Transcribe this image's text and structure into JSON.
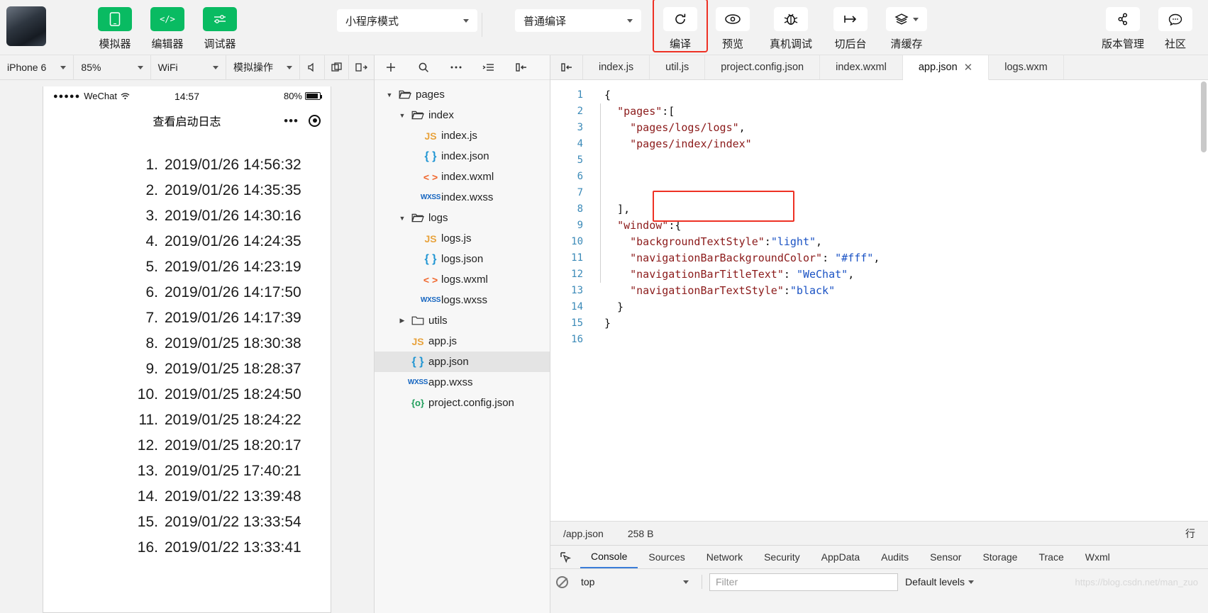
{
  "toolbar": {
    "avatar_name": "user-avatar",
    "panels": [
      {
        "label": "模拟器",
        "icon": "simulator-icon",
        "active": true
      },
      {
        "label": "编辑器",
        "icon": "editor-code-icon",
        "active": true
      },
      {
        "label": "调试器",
        "icon": "debugger-sliders-icon",
        "active": true
      }
    ],
    "mode_select": {
      "value": "小程序模式",
      "name": "mini-program-mode-select"
    },
    "compile_select": {
      "value": "普通编译",
      "name": "compile-mode-select"
    },
    "actions": [
      {
        "label": "编译",
        "icon": "refresh-icon",
        "highlighted": true
      },
      {
        "label": "预览",
        "icon": "eye-icon",
        "highlighted": false
      },
      {
        "label": "真机调试",
        "icon": "bug-icon",
        "highlighted": false
      },
      {
        "label": "切后台",
        "icon": "background-switch-icon",
        "highlighted": false
      },
      {
        "label": "清缓存",
        "icon": "layers-icon",
        "highlighted": false,
        "has_caret": true
      }
    ],
    "right_actions": [
      {
        "label": "版本管理",
        "icon": "git-branch-icon"
      },
      {
        "label": "社区",
        "icon": "chat-bubble-icon"
      }
    ],
    "highlight_color": "#ee3124",
    "accent_green": "#09bb62"
  },
  "simulator": {
    "controls": [
      {
        "value": "iPhone 6",
        "name": "device-select"
      },
      {
        "value": "85%",
        "name": "zoom-select"
      },
      {
        "value": "WiFi",
        "name": "network-select"
      },
      {
        "value": "模拟操作",
        "name": "simulate-action-select"
      }
    ],
    "icons": [
      "volume-icon",
      "copy-window-icon",
      "rotate-device-icon"
    ],
    "phone": {
      "status_bar": {
        "carrier": "WeChat",
        "signal_dots": "●●●●●",
        "time": "14:57",
        "battery_pct": "80%"
      },
      "nav_title": "查看启动日志",
      "logs": [
        {
          "index": "1.",
          "text": "2019/01/26 14:56:32"
        },
        {
          "index": "2.",
          "text": "2019/01/26 14:35:35"
        },
        {
          "index": "3.",
          "text": "2019/01/26 14:30:16"
        },
        {
          "index": "4.",
          "text": "2019/01/26 14:24:35"
        },
        {
          "index": "5.",
          "text": "2019/01/26 14:23:19"
        },
        {
          "index": "6.",
          "text": "2019/01/26 14:17:50"
        },
        {
          "index": "7.",
          "text": "2019/01/26 14:17:39"
        },
        {
          "index": "8.",
          "text": "2019/01/25 18:30:38"
        },
        {
          "index": "9.",
          "text": "2019/01/25 18:28:37"
        },
        {
          "index": "10.",
          "text": "2019/01/25 18:24:50"
        },
        {
          "index": "11.",
          "text": "2019/01/25 18:24:22"
        },
        {
          "index": "12.",
          "text": "2019/01/25 18:20:17"
        },
        {
          "index": "13.",
          "text": "2019/01/25 17:40:21"
        },
        {
          "index": "14.",
          "text": "2019/01/22 13:39:48"
        },
        {
          "index": "15.",
          "text": "2019/01/22 13:33:54"
        },
        {
          "index": "16.",
          "text": "2019/01/22 13:33:41"
        }
      ]
    }
  },
  "file_tree": {
    "toolbar_icons": [
      "add-file-icon",
      "search-icon",
      "more-icon",
      "collapse-list-icon",
      "hide-panel-icon"
    ],
    "nodes": [
      {
        "name": "pages",
        "type": "folder",
        "depth": 0,
        "expanded": true,
        "icon": "folder-open-icon"
      },
      {
        "name": "index",
        "type": "folder",
        "depth": 1,
        "expanded": true,
        "icon": "folder-open-icon"
      },
      {
        "name": "index.js",
        "type": "js",
        "depth": 2,
        "icon": "js-file-icon"
      },
      {
        "name": "index.json",
        "type": "json",
        "depth": 2,
        "icon": "json-file-icon"
      },
      {
        "name": "index.wxml",
        "type": "wxml",
        "depth": 2,
        "icon": "wxml-file-icon"
      },
      {
        "name": "index.wxss",
        "type": "wxss",
        "depth": 2,
        "icon": "wxss-file-icon"
      },
      {
        "name": "logs",
        "type": "folder",
        "depth": 1,
        "expanded": true,
        "icon": "folder-open-icon"
      },
      {
        "name": "logs.js",
        "type": "js",
        "depth": 2,
        "icon": "js-file-icon"
      },
      {
        "name": "logs.json",
        "type": "json",
        "depth": 2,
        "icon": "json-file-icon"
      },
      {
        "name": "logs.wxml",
        "type": "wxml",
        "depth": 2,
        "icon": "wxml-file-icon"
      },
      {
        "name": "logs.wxss",
        "type": "wxss",
        "depth": 2,
        "icon": "wxss-file-icon"
      },
      {
        "name": "utils",
        "type": "folder",
        "depth": 1,
        "expanded": false,
        "icon": "folder-closed-icon"
      },
      {
        "name": "app.js",
        "type": "js",
        "depth": 1,
        "icon": "js-file-icon"
      },
      {
        "name": "app.json",
        "type": "json",
        "depth": 1,
        "icon": "json-file-icon",
        "selected": true
      },
      {
        "name": "app.wxss",
        "type": "wxss",
        "depth": 1,
        "icon": "wxss-file-icon"
      },
      {
        "name": "project.config.json",
        "type": "proj",
        "depth": 1,
        "icon": "project-config-icon"
      }
    ]
  },
  "editor": {
    "tabs": [
      {
        "label": "index.js",
        "active": false,
        "closable": false
      },
      {
        "label": "util.js",
        "active": false,
        "closable": false
      },
      {
        "label": "project.config.json",
        "active": false,
        "closable": false
      },
      {
        "label": "index.wxml",
        "active": false,
        "closable": false
      },
      {
        "label": "app.json",
        "active": true,
        "closable": true
      },
      {
        "label": "logs.wxm",
        "active": false,
        "closable": false
      }
    ],
    "collapse_icon": "collapse-editor-icon",
    "close_glyph": "✕",
    "code_lines": [
      {
        "n": "1",
        "tokens": [
          {
            "t": "{",
            "c": "p"
          }
        ]
      },
      {
        "n": "2",
        "tokens": [
          {
            "t": "  ",
            "c": "p"
          },
          {
            "t": "\"pages\"",
            "c": "k"
          },
          {
            "t": ":[",
            "c": "p"
          }
        ]
      },
      {
        "n": "3",
        "tokens": [
          {
            "t": "    ",
            "c": "p"
          },
          {
            "t": "\"pages/logs/logs\"",
            "c": "k"
          },
          {
            "t": ",",
            "c": "p"
          }
        ]
      },
      {
        "n": "4",
        "tokens": [
          {
            "t": "    ",
            "c": "p"
          },
          {
            "t": "\"pages/index/index\"",
            "c": "k"
          }
        ]
      },
      {
        "n": "5",
        "tokens": []
      },
      {
        "n": "6",
        "tokens": []
      },
      {
        "n": "7",
        "tokens": []
      },
      {
        "n": "8",
        "tokens": [
          {
            "t": "  ],",
            "c": "p"
          }
        ]
      },
      {
        "n": "9",
        "tokens": [
          {
            "t": "  ",
            "c": "p"
          },
          {
            "t": "\"window\"",
            "c": "k"
          },
          {
            "t": ":{",
            "c": "p"
          }
        ]
      },
      {
        "n": "10",
        "tokens": [
          {
            "t": "    ",
            "c": "p"
          },
          {
            "t": "\"backgroundTextStyle\"",
            "c": "k"
          },
          {
            "t": ":",
            "c": "p"
          },
          {
            "t": "\"light\"",
            "c": "v"
          },
          {
            "t": ",",
            "c": "p"
          }
        ]
      },
      {
        "n": "11",
        "tokens": [
          {
            "t": "    ",
            "c": "p"
          },
          {
            "t": "\"navigationBarBackgroundColor\"",
            "c": "k"
          },
          {
            "t": ": ",
            "c": "p"
          },
          {
            "t": "\"#fff\"",
            "c": "v"
          },
          {
            "t": ",",
            "c": "p"
          }
        ]
      },
      {
        "n": "12",
        "tokens": [
          {
            "t": "    ",
            "c": "p"
          },
          {
            "t": "\"navigationBarTitleText\"",
            "c": "k"
          },
          {
            "t": ": ",
            "c": "p"
          },
          {
            "t": "\"WeChat\"",
            "c": "v"
          },
          {
            "t": ",",
            "c": "p"
          }
        ]
      },
      {
        "n": "13",
        "tokens": [
          {
            "t": "    ",
            "c": "p"
          },
          {
            "t": "\"navigationBarTextStyle\"",
            "c": "k"
          },
          {
            "t": ":",
            "c": "p"
          },
          {
            "t": "\"black\"",
            "c": "v"
          }
        ]
      },
      {
        "n": "14",
        "tokens": [
          {
            "t": "  }",
            "c": "p"
          }
        ]
      },
      {
        "n": "15",
        "tokens": [
          {
            "t": "}",
            "c": "p"
          }
        ]
      },
      {
        "n": "16",
        "tokens": []
      }
    ],
    "status": {
      "path": "/app.json",
      "size": "258 B",
      "right_label": "行"
    }
  },
  "console": {
    "inspect_icon": "inspect-element-icon",
    "tabs": [
      {
        "label": "Console",
        "active": true
      },
      {
        "label": "Sources",
        "active": false
      },
      {
        "label": "Network",
        "active": false
      },
      {
        "label": "Security",
        "active": false
      },
      {
        "label": "AppData",
        "active": false
      },
      {
        "label": "Audits",
        "active": false
      },
      {
        "label": "Sensor",
        "active": false
      },
      {
        "label": "Storage",
        "active": false
      },
      {
        "label": "Trace",
        "active": false
      },
      {
        "label": "Wxml",
        "active": false
      }
    ],
    "clear_icon": "clear-console-icon",
    "context_select": {
      "value": "top",
      "name": "execution-context-select"
    },
    "filter_input": {
      "value": "",
      "placeholder": "Filter",
      "name": "console-filter-input"
    },
    "levels_select": {
      "value": "Default levels",
      "name": "log-levels-select"
    },
    "watermark": "https://blog.csdn.net/man_zuo"
  }
}
